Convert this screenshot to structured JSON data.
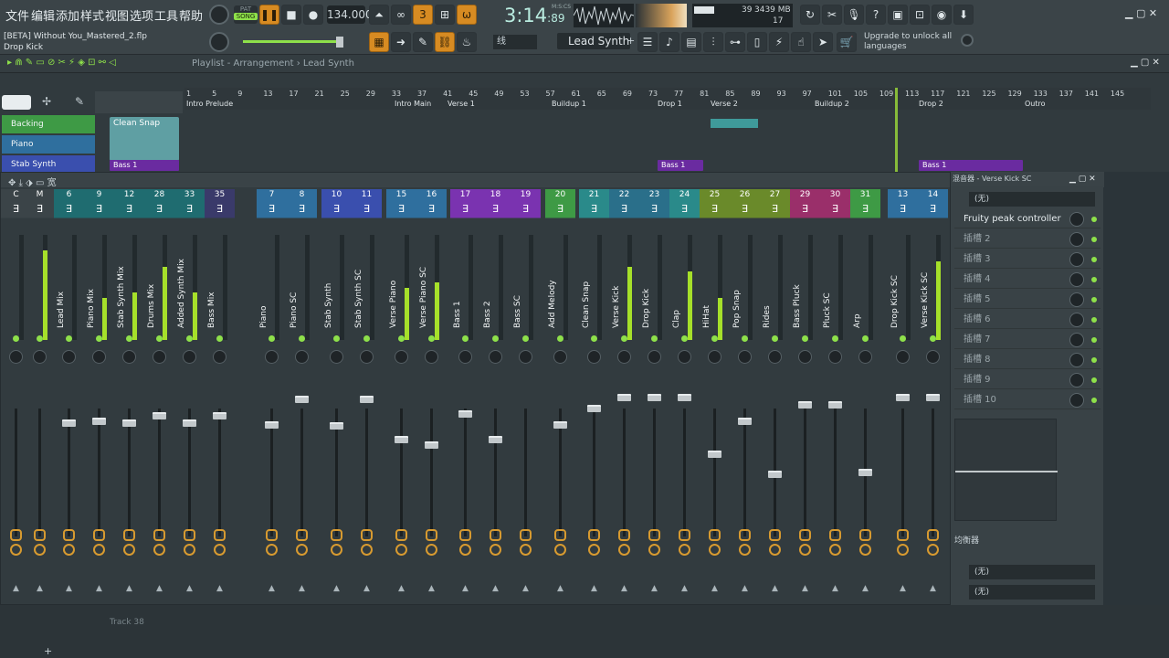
{
  "menu": [
    "文件",
    "编辑",
    "添加",
    "样式",
    "视图",
    "选项",
    "工具",
    "帮助"
  ],
  "transport": {
    "pat_label": "PAT",
    "song_label": "SONG",
    "tempo": "134.000",
    "time": "3:14",
    "time_sub": ":89",
    "time_unit": "M:S:CS"
  },
  "cpu": {
    "mem": "3439 MB",
    "val1": "39",
    "val2": "17"
  },
  "project": {
    "title": "[BETA] Without You_Mastered_2.flp",
    "channel": "Drop Kick"
  },
  "synth_select": "Lead Synth",
  "upgrade_text": "Upgrade to unlock all languages",
  "plug_sel": "线",
  "breadcrumb": "Playlist - Arrangement › Lead Synth",
  "ruler": {
    "bars": [
      "1",
      "5",
      "9",
      "13",
      "17",
      "21",
      "25",
      "29",
      "33",
      "37",
      "41",
      "45",
      "49",
      "53",
      "57",
      "61",
      "65",
      "69",
      "73",
      "77",
      "81",
      "85",
      "89",
      "93",
      "97",
      "101",
      "105",
      "109",
      "113",
      "117",
      "121",
      "125",
      "129",
      "133",
      "137",
      "141",
      "145"
    ],
    "markers": [
      {
        "label": "Intro Prelude"
      },
      {
        "label": "Intro Main"
      },
      {
        "label": "Verse 1"
      },
      {
        "label": "Buildup 1"
      },
      {
        "label": "Drop 1"
      },
      {
        "label": "Verse 2"
      },
      {
        "label": "Buildup 2"
      },
      {
        "label": "Drop 2"
      },
      {
        "label": "Outro"
      }
    ]
  },
  "tracks": [
    {
      "name": "Backing",
      "color": "#3e9a45"
    },
    {
      "name": "Piano",
      "color": "#2f6f9e"
    },
    {
      "name": "Stab Synth",
      "color": "#3a4fae"
    }
  ],
  "clips": {
    "clean_snap": "Clean Snap",
    "bass1": "Bass 1"
  },
  "mixer": {
    "title": "混音器 - Verse Kick SC",
    "strips": [
      {
        "num": "C",
        "name": "",
        "color": "#3b4448",
        "level": 0.0
      },
      {
        "num": "M",
        "name": "",
        "color": "#3b4448",
        "level": 0.85
      },
      {
        "num": "6",
        "name": "Lead Mix",
        "color": "#1f6c70",
        "level": 0.0
      },
      {
        "num": "9",
        "name": "Piano Mix",
        "color": "#1f6c70",
        "level": 0.4
      },
      {
        "num": "12",
        "name": "Stab Synth Mix",
        "color": "#1f6c70",
        "level": 0.45
      },
      {
        "num": "28",
        "name": "Drums Mix",
        "color": "#1f6c70",
        "level": 0.7
      },
      {
        "num": "33",
        "name": "Added Synth Mix",
        "color": "#1f6c70",
        "level": 0.45
      },
      {
        "num": "35",
        "name": "Bass Mix",
        "color": "#3a3a6a",
        "level": 0.0
      },
      {
        "num": "7",
        "name": "Piano",
        "color": "#2f6f9e",
        "level": 0.0
      },
      {
        "num": "8",
        "name": "Piano SC",
        "color": "#2f6f9e",
        "level": 0.0
      },
      {
        "num": "10",
        "name": "Stab Synth",
        "color": "#3a4fae",
        "level": 0.0
      },
      {
        "num": "11",
        "name": "Stab Synth SC",
        "color": "#3a4fae",
        "level": 0.0
      },
      {
        "num": "15",
        "name": "Verse Piano",
        "color": "#2f6f9e",
        "level": 0.5
      },
      {
        "num": "16",
        "name": "Verse Piano SC",
        "color": "#2f6f9e",
        "level": 0.55
      },
      {
        "num": "17",
        "name": "Bass 1",
        "color": "#7a33b0",
        "level": 0.0
      },
      {
        "num": "18",
        "name": "Bass 2",
        "color": "#7a33b0",
        "level": 0.0
      },
      {
        "num": "19",
        "name": "Bass SC",
        "color": "#7a33b0",
        "level": 0.0
      },
      {
        "num": "20",
        "name": "Add Melody",
        "color": "#3e9a45",
        "level": 0.0
      },
      {
        "num": "21",
        "name": "Clean Snap",
        "color": "#2a8a8a",
        "level": 0.0
      },
      {
        "num": "22",
        "name": "Verse Kick",
        "color": "#2a6f8a",
        "level": 0.7
      },
      {
        "num": "23",
        "name": "Drop Kick",
        "color": "#2a6f8a",
        "level": 0.0
      },
      {
        "num": "24",
        "name": "Clap",
        "color": "#2a8a8a",
        "level": 0.65
      },
      {
        "num": "25",
        "name": "HiHat",
        "color": "#6a8a2a",
        "level": 0.4
      },
      {
        "num": "26",
        "name": "Pop Snap",
        "color": "#6a8a2a",
        "level": 0.0
      },
      {
        "num": "27",
        "name": "Rides",
        "color": "#6a8a2a",
        "level": 0.0
      },
      {
        "num": "29",
        "name": "Bass Pluck",
        "color": "#9a2f6a",
        "level": 0.0
      },
      {
        "num": "30",
        "name": "Pluck SC",
        "color": "#9a2f6a",
        "level": 0.0
      },
      {
        "num": "31",
        "name": "Arp",
        "color": "#3e9a45",
        "level": 0.0
      },
      {
        "num": "13",
        "name": "Drop Kick SC",
        "color": "#2f6f9e",
        "level": 0.0
      },
      {
        "num": "14",
        "name": "Verse Kick SC",
        "color": "#2f6f9e",
        "level": 0.75
      }
    ]
  },
  "panel": {
    "input": "(无)",
    "slots": [
      "Fruity peak controller",
      "插槽 2",
      "插槽 3",
      "插槽 4",
      "插槽 5",
      "插槽 6",
      "插槽 7",
      "插槽 8",
      "插槽 9",
      "插槽 10"
    ],
    "eq_label": "均衡器",
    "out1": "(无)",
    "out2": "(无)"
  },
  "bottom": {
    "track38": "Track 38"
  }
}
